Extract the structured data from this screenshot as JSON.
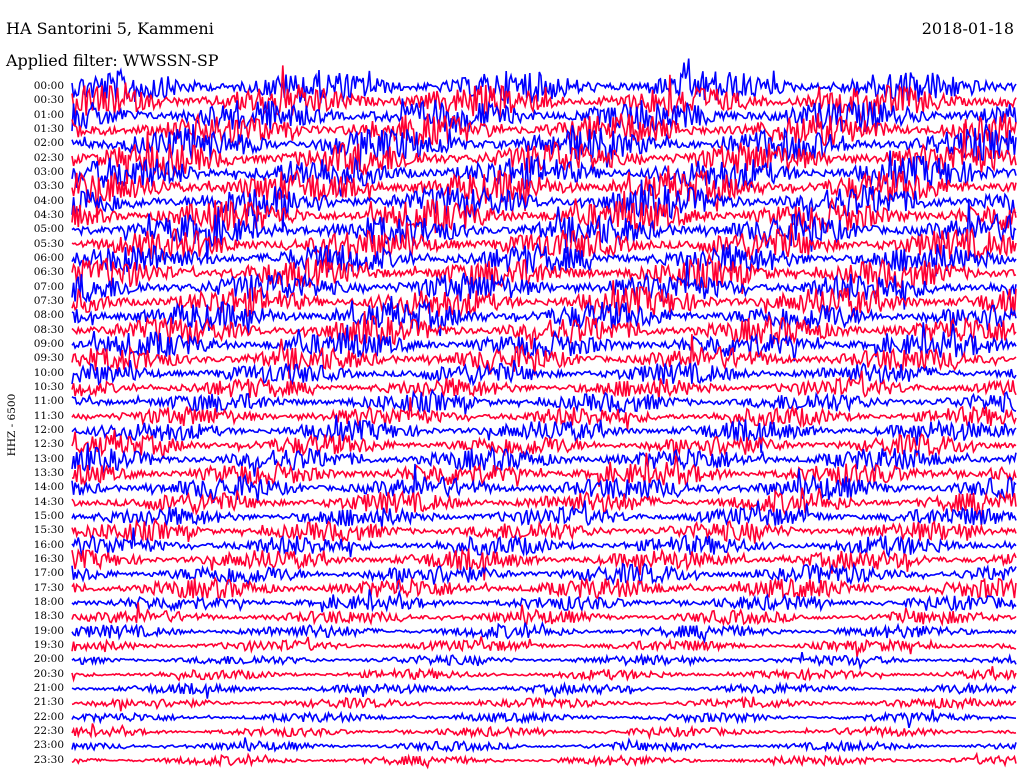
{
  "header": {
    "title": "HA Santorini 5, Kammeni",
    "date": "2018-01-18",
    "filter": "Applied filter: WWSSN-SP"
  },
  "channel_label": "HHZ - 6500",
  "colors": {
    "trace_a": "#0000ff",
    "trace_b": "#ff0033",
    "background": "#ffffff"
  },
  "chart_data": {
    "type": "line",
    "title": "HA Santorini 5, Kammeni",
    "ylabel": "HHZ - 6500",
    "series": [],
    "y_tick_labels": [
      "00:00",
      "00:30",
      "01:00",
      "01:30",
      "02:00",
      "02:30",
      "03:00",
      "03:30",
      "04:00",
      "04:30",
      "05:00",
      "05:30",
      "06:00",
      "06:30",
      "07:00",
      "07:30",
      "08:00",
      "08:30",
      "09:00",
      "09:30",
      "10:00",
      "10:30",
      "11:00",
      "11:30",
      "12:00",
      "12:30",
      "13:00",
      "13:30",
      "14:00",
      "14:30",
      "15:00",
      "15:30",
      "16:00",
      "16:30",
      "17:00",
      "17:30",
      "18:00",
      "18:30",
      "19:00",
      "19:30",
      "20:00",
      "20:30",
      "21:00",
      "21:30",
      "22:00",
      "22:30",
      "23:00",
      "23:30"
    ],
    "trace_line_colors": [
      "#0000ff",
      "#ff0033"
    ],
    "relative_amplitude_by_row": [
      1.0,
      1.0,
      1.0,
      1.0,
      1.0,
      1.0,
      1.0,
      1.0,
      1.0,
      1.0,
      0.95,
      0.95,
      0.9,
      0.9,
      0.9,
      0.9,
      0.88,
      0.85,
      0.8,
      0.75,
      0.65,
      0.6,
      0.6,
      0.6,
      0.62,
      0.65,
      0.7,
      0.72,
      0.7,
      0.65,
      0.6,
      0.6,
      0.6,
      0.6,
      0.62,
      0.62,
      0.45,
      0.42,
      0.4,
      0.35,
      0.3,
      0.3,
      0.3,
      0.3,
      0.28,
      0.28,
      0.28,
      0.28
    ],
    "grid": false
  }
}
